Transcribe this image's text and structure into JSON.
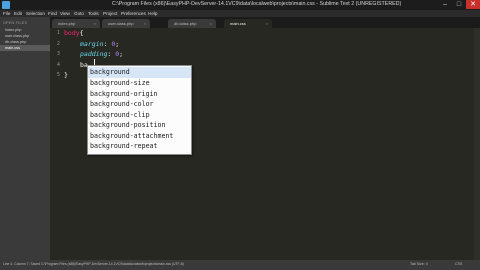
{
  "window": {
    "title": "C:\\Program Files (x86)\\EasyPHP-DevServer-14.1VC9\\data\\localweb\\projects\\main.css - Sublime Text 2 (UNREGISTERED)",
    "minimize": "–",
    "maximize": "□",
    "close": "✕"
  },
  "menu": [
    "File",
    "Edit",
    "Selection",
    "Find",
    "View",
    "Goto",
    "Tools",
    "Project",
    "Preferences",
    "Help"
  ],
  "sidebar": {
    "header": "OPEN FILES",
    "files": [
      "index.php",
      "user.class.php",
      "db.class.php",
      "main.css"
    ],
    "active_index": 3
  },
  "tabs": [
    {
      "label": "index.php"
    },
    {
      "label": "user.class.php"
    },
    {
      "label": "db.class.php"
    },
    {
      "label": "main.css"
    }
  ],
  "active_tab": 3,
  "editor": {
    "line_numbers": [
      "1",
      "2",
      "3",
      "4",
      "5"
    ],
    "lines": {
      "l1_selector": "body",
      "l1_brace": "{",
      "l2_prop": "margin",
      "l2_colon": ": ",
      "l2_value": "0",
      "l2_semi": ";",
      "l3_prop": "padding",
      "l3_colon": ": ",
      "l3_value": "0",
      "l3_semi": ";",
      "l4_text": "ba",
      "l5_brace": "}"
    }
  },
  "autocomplete": {
    "items": [
      "background",
      "background-size",
      "background-origin",
      "background-color",
      "background-clip",
      "background-position",
      "background-attachment",
      "background-repeat"
    ],
    "selected_index": 0
  },
  "statusbar": {
    "text": "Line 4, Column 7; Saved C:\\Program Files (x86)\\EasyPHP-DevServer-14.1VC9\\data\\localweb\\projects\\main.css (UTF-8)",
    "tab_size": "Tab Size: 4",
    "syntax": "CSS"
  }
}
